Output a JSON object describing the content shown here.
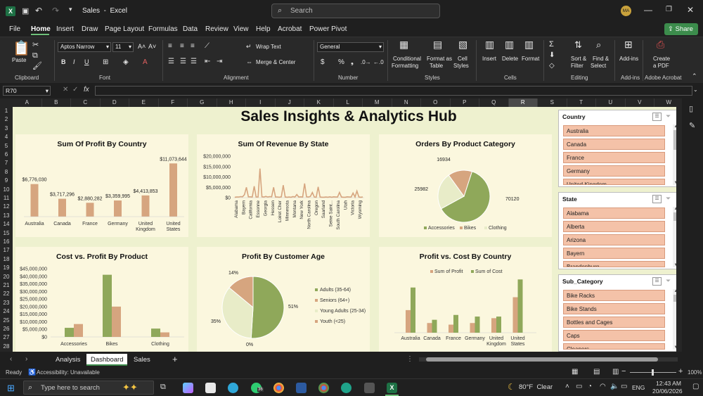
{
  "titlebar": {
    "app_title": "Sales  -  Excel",
    "search_placeholder": "Search",
    "avatar": "MA"
  },
  "menu": [
    "File",
    "Home",
    "Insert",
    "Draw",
    "Page Layout",
    "Formulas",
    "Data",
    "Review",
    "View",
    "Help",
    "Acrobat",
    "Power Pivot"
  ],
  "share_label": "Share",
  "ribbon": {
    "paste": "Paste",
    "clipboard": "Clipboard",
    "font_name": "Aptos Narrow",
    "font_size": "11",
    "font": "Font",
    "wrap": "Wrap Text",
    "merge": "Merge & Center",
    "alignment": "Alignment",
    "number_format": "General",
    "number": "Number",
    "cond": "Conditional",
    "cond2": "Formatting",
    "fmt_table": "Format as",
    "fmt_table2": "Table",
    "cell_styles": "Cell",
    "cell_styles2": "Styles",
    "styles": "Styles",
    "insert": "Insert",
    "delete": "Delete",
    "format": "Format",
    "cells": "Cells",
    "sort": "Sort &",
    "sort2": "Filter",
    "find": "Find &",
    "find2": "Select",
    "editing": "Editing",
    "addins": "Add-ins",
    "addins_grp": "Add-ins",
    "create_pdf": "Create",
    "create_pdf2": "a PDF",
    "acrobat": "Adobe Acrobat",
    "bold": "B",
    "italic": "I",
    "underline": "U"
  },
  "formula": {
    "name_box": "R70",
    "fx": "fx",
    "content": ""
  },
  "columns": [
    "A",
    "B",
    "C",
    "D",
    "E",
    "F",
    "G",
    "H",
    "I",
    "J",
    "K",
    "L",
    "M",
    "N",
    "O",
    "P",
    "Q",
    "R",
    "S",
    "T",
    "U",
    "V",
    "W"
  ],
  "rows": [
    "1",
    "2",
    "3",
    "4",
    "5",
    "6",
    "7",
    "8",
    "9",
    "10",
    "11",
    "12",
    "13",
    "14",
    "15",
    "16",
    "17",
    "18",
    "19",
    "20",
    "21",
    "22",
    "23",
    "24",
    "25",
    "26",
    "27",
    "28"
  ],
  "dashboard": {
    "title": "Sales Insights & Analytics Hub",
    "c1_title": "Sum Of Profit By Country",
    "c2_title": "Sum Of Revenue By State",
    "c3_title": "Orders By Product Category",
    "c4_title": "Cost vs. Profit By Product",
    "c5_title": "Profit By Customer Age",
    "c6_title": "Profit vs. Cost By Country"
  },
  "chart_data": [
    {
      "type": "bar",
      "title": "Sum Of Profit By Country",
      "categories": [
        "Australia",
        "Canada",
        "France",
        "Germany",
        "United Kingdom",
        "United States"
      ],
      "values": [
        6776030,
        3717296,
        2880282,
        3359995,
        4413853,
        11073644
      ],
      "labels": [
        "$6,776,030",
        "$3,717,296",
        "$2,880,282",
        "$3,359,995",
        "$4,413,853",
        "$11,073,644"
      ],
      "color": "#d6a57f"
    },
    {
      "type": "line",
      "title": "Sum Of Revenue By State",
      "ylim": [
        0,
        20000000
      ],
      "y_ticks": [
        "$20,000,000",
        "$15,000,000",
        "$10,000,000",
        "$5,000,000",
        "$0"
      ],
      "x_tick_labels": [
        "Alabama",
        "Bayern",
        "California",
        "Essonne",
        "Georgia",
        "Hessen",
        "Loiret Cher",
        "Minnesota",
        "Montana",
        "New York",
        "North Carolina",
        "Oregon",
        "Saarland",
        "Seine Saint...",
        "South Carolina",
        "Utah",
        "Victoria",
        "Wyoming"
      ],
      "values": [
        0.2,
        0.3,
        0.3,
        0.5,
        0.4,
        1.5,
        5.0,
        0.4,
        0.4,
        0.3,
        5.5,
        0.3,
        0.3,
        14.0,
        0.4,
        0.3,
        0.6,
        0.3,
        0.5,
        0.4,
        5.0,
        0.3,
        0.3,
        0.2,
        0.4,
        6.0,
        0.3,
        0.2,
        0.3,
        0.2,
        0.5,
        0.3,
        1.5,
        0.3,
        0.4,
        0.3,
        6.8,
        0.4,
        0.3,
        0.6,
        2.5,
        0.3,
        0.2,
        5.2,
        0.3,
        0.2,
        0.2,
        0.3,
        0.2,
        0.4,
        0.2,
        0.4,
        0.3,
        0.3,
        2.5,
        0.3,
        0.2,
        0.2,
        0.4,
        0.3,
        0.3,
        2.2,
        0.3,
        3.2,
        0.3,
        0.2,
        0.3
      ],
      "color": "#d6a57f"
    },
    {
      "type": "pie",
      "title": "Orders By Product Category",
      "slices": [
        {
          "name": "Accessories",
          "value": 70120,
          "color": "#8fa85a"
        },
        {
          "name": "Bikes",
          "value": 16934,
          "color": "#d6a57f"
        },
        {
          "name": "Clothing",
          "value": 25982,
          "color": "#e8ecc8"
        }
      ],
      "legend": [
        "Accessories",
        "Bikes",
        "Clothing"
      ],
      "labels": [
        "70120",
        "16934",
        "25982"
      ]
    },
    {
      "type": "bar",
      "title": "Cost vs. Profit By Product",
      "categories": [
        "Accessories",
        "Bikes",
        "Clothing"
      ],
      "series": [
        {
          "values": [
            6000000,
            41000000,
            5500000
          ],
          "color": "#8fa85a"
        },
        {
          "values": [
            8500000,
            20000000,
            3000000
          ],
          "color": "#d6a57f"
        }
      ],
      "ylim": [
        0,
        45000000
      ],
      "y_ticks": [
        "$45,000,000",
        "$40,000,000",
        "$35,000,000",
        "$30,000,000",
        "$25,000,000",
        "$20,000,000",
        "$15,000,000",
        "$10,000,000",
        "$5,000,000",
        "$0"
      ]
    },
    {
      "type": "pie",
      "title": "Profit By Customer Age",
      "slices": [
        {
          "name": "Adults (35-64)",
          "value": 51,
          "color": "#8fa85a"
        },
        {
          "name": "Seniors (64+)",
          "value": 0,
          "color": "#d6a57f"
        },
        {
          "name": "Young Adults (25-34)",
          "value": 35,
          "color": "#e8ecc8"
        },
        {
          "name": "Youth (<25)",
          "value": 14,
          "color": "#d6a57f"
        }
      ],
      "labels": [
        "51%",
        "0%",
        "35%",
        "14%"
      ],
      "legend": [
        "Adults (35-64)",
        "Seniors (64+)",
        "Young Adults (25-34)",
        "Youth (<25)"
      ]
    },
    {
      "type": "bar",
      "title": "Profit vs. Cost By Country",
      "categories": [
        "Australia",
        "Canada",
        "France",
        "Germany",
        "United Kingdom",
        "United States"
      ],
      "series": [
        {
          "name": "Sum of Profit",
          "values": [
            7,
            3,
            2.5,
            3,
            4.5,
            11
          ],
          "color": "#d6a57f"
        },
        {
          "name": "Sum of Cost",
          "values": [
            14,
            4,
            5.5,
            5,
            5,
            16.5
          ],
          "color": "#8fa85a"
        }
      ],
      "legend": [
        "Sum of Profit",
        "Sum of Cost"
      ]
    }
  ],
  "slicers": [
    {
      "title": "Country",
      "items": [
        "Australia",
        "Canada",
        "France",
        "Germany",
        "United Kingdom"
      ]
    },
    {
      "title": "State",
      "items": [
        "Alabama",
        "Alberta",
        "Arizona",
        "Bayern",
        "Brandenburg"
      ]
    },
    {
      "title": "Sub_Category",
      "items": [
        "Bike Racks",
        "Bike Stands",
        "Bottles and Cages",
        "Caps",
        "Cleaners"
      ]
    }
  ],
  "sheet_tabs": [
    "Analysis",
    "Dashboard",
    "Sales"
  ],
  "status": {
    "ready": "Ready",
    "accessibility": "Accessibility: Unavailable",
    "zoom": "100%"
  },
  "taskbar": {
    "search": "Type here to search",
    "weather": "80°F  Clear",
    "lang": "ENG",
    "time": "12:43 AM",
    "date": "20/06/2026",
    "badge": "36"
  }
}
